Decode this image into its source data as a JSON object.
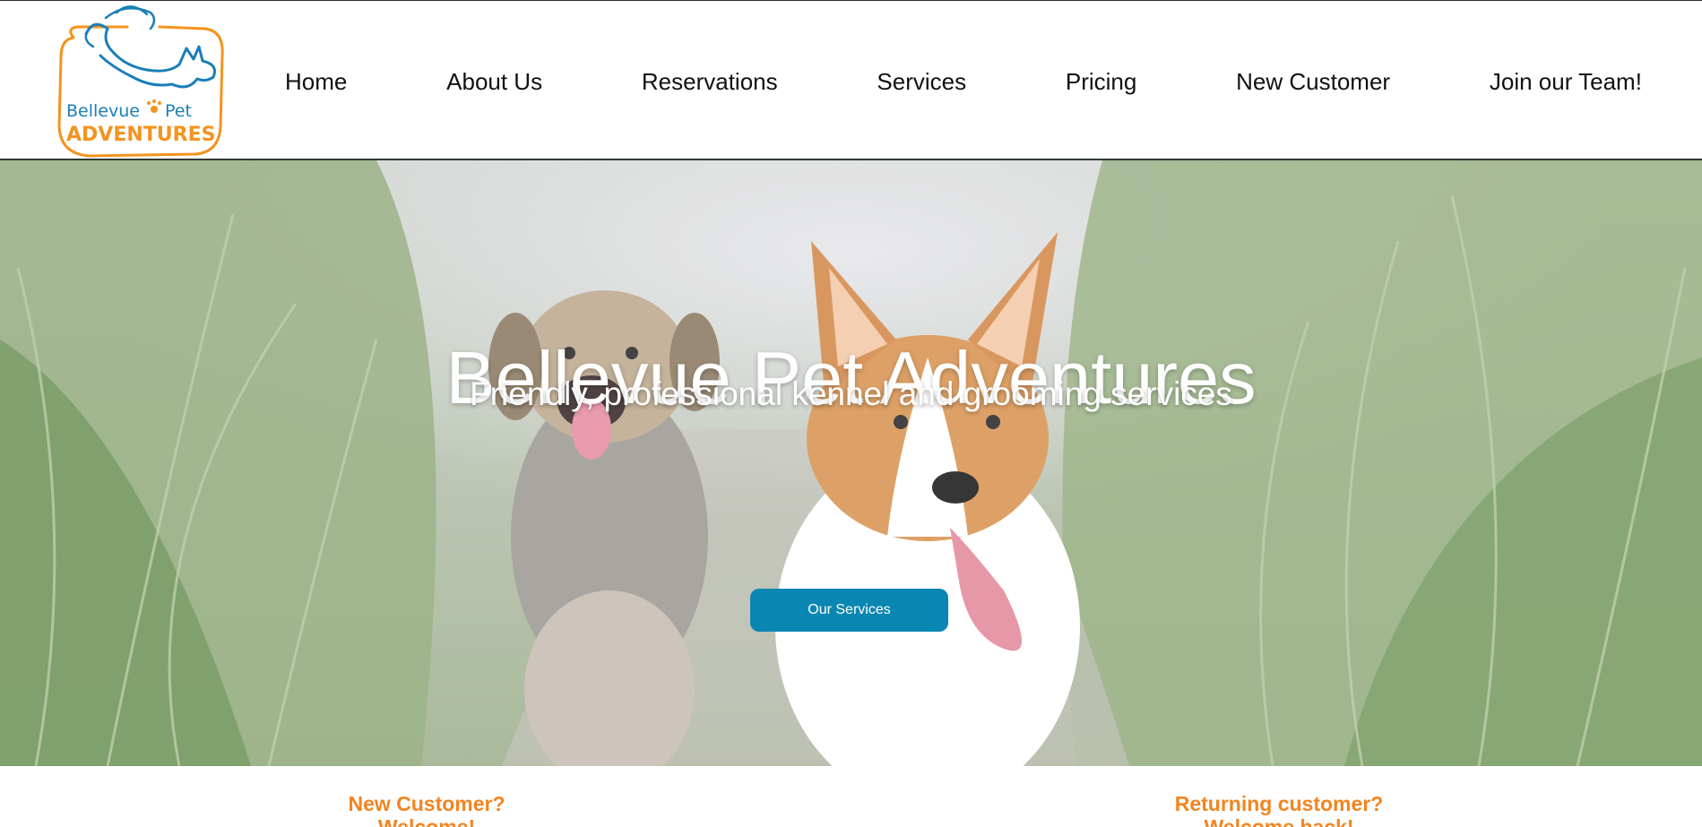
{
  "brand": {
    "logo_line1": "Bellevue",
    "logo_line1b": "Pet",
    "logo_line2": "ADVENTURES",
    "logo_blue": "#1a7fb8",
    "logo_orange": "#f4931f"
  },
  "nav": {
    "items": [
      {
        "label": "Home"
      },
      {
        "label": "About Us"
      },
      {
        "label": "Reservations"
      },
      {
        "label": "Services"
      },
      {
        "label": "Pricing"
      },
      {
        "label": "New Customer"
      },
      {
        "label": "Join our Team!"
      }
    ]
  },
  "hero": {
    "title": "Bellevue Pet Adventures",
    "subtitle": "Friendly, professional kennel and grooming services",
    "cta_label": "Our Services",
    "cta_color": "#0a86b2"
  },
  "sections": {
    "new_customer_heading": "New Customer?",
    "new_customer_line2": "Welcome!",
    "returning_heading": "Returning customer?",
    "returning_line2": "Welcome back!",
    "accent_color": "#f4841f"
  }
}
